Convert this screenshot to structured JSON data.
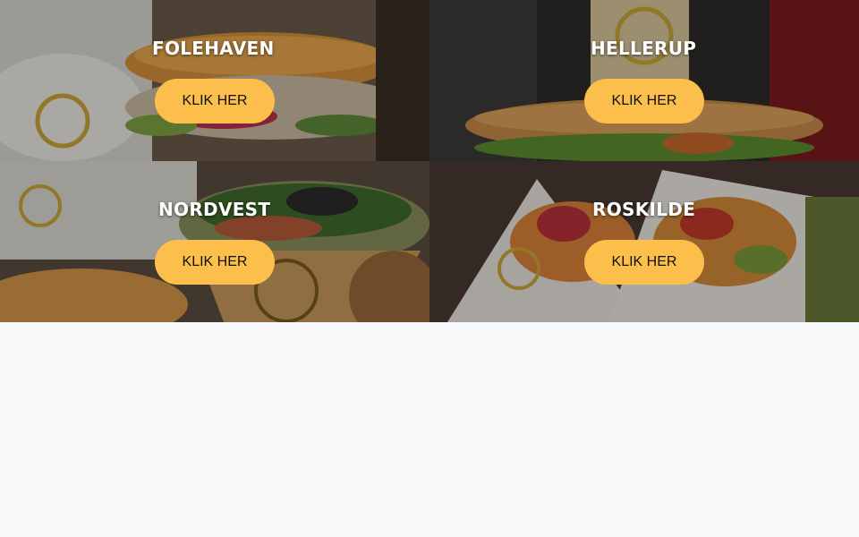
{
  "locations": [
    {
      "name": "FOLEHAVEN",
      "button_label": "KLIK HER"
    },
    {
      "name": "HELLERUP",
      "button_label": "KLIK HER"
    },
    {
      "name": "NORDVEST",
      "button_label": "KLIK HER"
    },
    {
      "name": "ROSKILDE",
      "button_label": "KLIK HER"
    }
  ],
  "colors": {
    "button": "#fcbf4b",
    "button_text": "#111111",
    "title_text": "#ffffff",
    "page_background": "#f8f9fb"
  }
}
